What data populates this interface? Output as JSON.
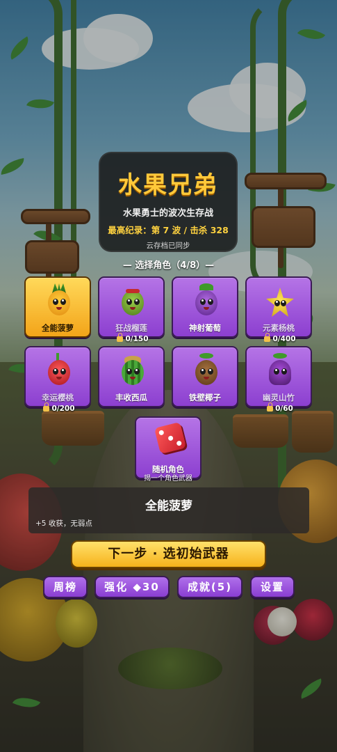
{
  "title_panel": {
    "title": "水果兄弟",
    "subtitle": "水果勇士的波次生存战",
    "best_record": "最高纪录：第 7 波 / 击杀 328",
    "cloud_save": "云存档已同步"
  },
  "character_select": {
    "header": "— 选择角色（4/8）—",
    "characters": [
      {
        "name": "全能菠萝",
        "selected": true,
        "locked": false,
        "unlock": ""
      },
      {
        "name": "狂战榴莲",
        "selected": false,
        "locked": true,
        "unlock": "0/150"
      },
      {
        "name": "神射葡萄",
        "selected": false,
        "locked": false,
        "unlock": ""
      },
      {
        "name": "元素杨桃",
        "selected": false,
        "locked": true,
        "unlock": "0/400"
      },
      {
        "name": "幸运樱桃",
        "selected": false,
        "locked": true,
        "unlock": "0/200"
      },
      {
        "name": "丰收西瓜",
        "selected": false,
        "locked": false,
        "unlock": ""
      },
      {
        "name": "铁壁椰子",
        "selected": false,
        "locked": false,
        "unlock": ""
      },
      {
        "name": "幽灵山竹",
        "selected": false,
        "locked": true,
        "unlock": "0/60"
      }
    ],
    "random": {
      "name": "随机角色",
      "sub": "揭一个角色武器"
    }
  },
  "description": {
    "name": "全能菠萝",
    "text": "+5 收获，无弱点"
  },
  "buttons": {
    "next": "下一步 · 选初始武器",
    "weekly": "周榜",
    "upgrade": "强化 ◆30",
    "achievements": "成就(5)",
    "settings": "设置"
  },
  "colors": {
    "accent_gold": "#ffc93a",
    "card_purple": "#9b4fdc",
    "card_selected": "#f7b62a"
  }
}
